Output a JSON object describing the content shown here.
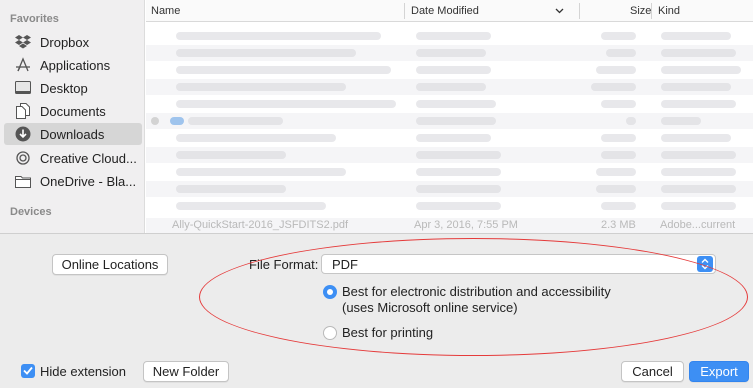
{
  "sidebar": {
    "favorites_header": "Favorites",
    "devices_header": "Devices",
    "items": [
      {
        "label": "Dropbox",
        "icon": "dropbox-icon"
      },
      {
        "label": "Applications",
        "icon": "applications-icon"
      },
      {
        "label": "Desktop",
        "icon": "desktop-icon"
      },
      {
        "label": "Documents",
        "icon": "documents-icon"
      },
      {
        "label": "Downloads",
        "icon": "downloads-icon",
        "selected": true
      },
      {
        "label": "Creative Cloud...",
        "icon": "creative-cloud-icon"
      },
      {
        "label": "OneDrive - Bla...",
        "icon": "folder-icon"
      }
    ]
  },
  "file_list": {
    "columns": {
      "name": "Name",
      "date": "Date Modified",
      "size": "Size",
      "kind": "Kind"
    },
    "last_row": {
      "name": "Ally-QuickStart-2016_JSFDITS2.pdf",
      "date": "Apr 3, 2016, 7:55 PM",
      "size": "2.3 MB",
      "kind": "Adobe...current"
    }
  },
  "options": {
    "online_locations_label": "Online Locations",
    "file_format_label": "File Format:",
    "file_format_value": "PDF",
    "radio_accessibility_line1": "Best for electronic distribution and accessibility",
    "radio_accessibility_line2": "(uses Microsoft online service)",
    "radio_printing": "Best for printing",
    "selected_option": "accessibility"
  },
  "footer": {
    "hide_extension_label": "Hide extension",
    "hide_extension_checked": true,
    "new_folder_label": "New Folder",
    "cancel_label": "Cancel",
    "export_label": "Export"
  },
  "colors": {
    "accent": "#3d8ff4",
    "annotation": "#e53b3b"
  }
}
